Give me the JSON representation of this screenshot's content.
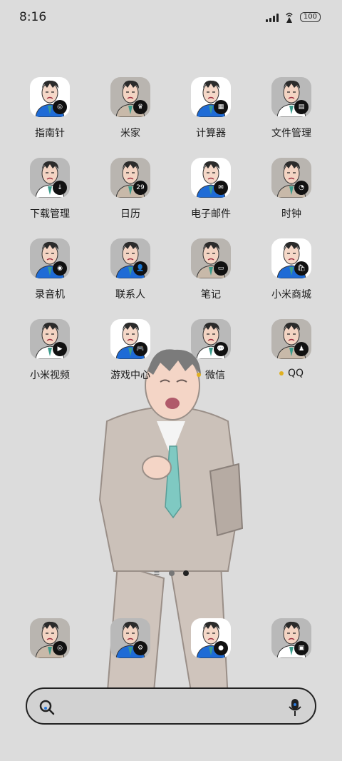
{
  "status_bar": {
    "time": "8:16",
    "battery": "100"
  },
  "apps": [
    {
      "label": "指南针",
      "icon": "compass-icon",
      "bg": "#ffffff",
      "shirt": "#1e6bd6",
      "badge": "◎"
    },
    {
      "label": "米家",
      "icon": "mijia-icon",
      "bg": "#b9b5b0",
      "shirt": "#c8b9a9",
      "badge": "♛"
    },
    {
      "label": "计算器",
      "icon": "calculator-icon",
      "bg": "#ffffff",
      "shirt": "#1e6bd6",
      "badge": "▦"
    },
    {
      "label": "文件管理",
      "icon": "file-manager-icon",
      "bg": "#b9b9b9",
      "shirt": "#ffffff",
      "badge": "▤"
    },
    {
      "label": "下载管理",
      "icon": "download-manager-icon",
      "bg": "#b9b9b9",
      "shirt": "#ffffff",
      "badge": "↓"
    },
    {
      "label": "日历",
      "icon": "calendar-icon",
      "bg": "#b9b5b0",
      "shirt": "#c8b9a9",
      "badge": "29"
    },
    {
      "label": "电子邮件",
      "icon": "email-icon",
      "bg": "#ffffff",
      "shirt": "#1e6bd6",
      "badge": "✉"
    },
    {
      "label": "时钟",
      "icon": "clock-icon",
      "bg": "#b9b5b0",
      "shirt": "#c8b9a9",
      "badge": "◔"
    },
    {
      "label": "录音机",
      "icon": "recorder-icon",
      "bg": "#b9b9b9",
      "shirt": "#1e6bd6",
      "badge": "◉"
    },
    {
      "label": "联系人",
      "icon": "contacts-icon",
      "bg": "#b9b9b9",
      "shirt": "#1e6bd6",
      "badge": "👤"
    },
    {
      "label": "笔记",
      "icon": "notes-icon",
      "bg": "#b9b5b0",
      "shirt": "#c8b9a9",
      "badge": "▭"
    },
    {
      "label": "小米商城",
      "icon": "mi-store-icon",
      "bg": "#ffffff",
      "shirt": "#1e6bd6",
      "badge": "🛍"
    },
    {
      "label": "小米视频",
      "icon": "mi-video-icon",
      "bg": "#b9b9b9",
      "shirt": "#ffffff",
      "badge": "▶"
    },
    {
      "label": "游戏中心",
      "icon": "game-center-icon",
      "bg": "#ffffff",
      "shirt": "#1e6bd6",
      "badge": "🎮"
    },
    {
      "label": "微信",
      "icon": "wechat-icon",
      "bg": "#b9b9b9",
      "shirt": "#ffffff",
      "badge": "💬",
      "dot": true
    },
    {
      "label": "QQ",
      "icon": "qq-icon",
      "bg": "#b9b5b0",
      "shirt": "#c8b9a9",
      "badge": "♟",
      "dot": true
    }
  ],
  "dock": [
    {
      "icon": "camera-icon",
      "bg": "#b9b5b0",
      "shirt": "#c8b9a9",
      "badge": "◎"
    },
    {
      "icon": "settings-icon",
      "bg": "#b9b9b9",
      "shirt": "#1e6bd6",
      "badge": "⚙"
    },
    {
      "icon": "messages-icon",
      "bg": "#ffffff",
      "shirt": "#1e6bd6",
      "badge": "●"
    },
    {
      "icon": "gallery-icon",
      "bg": "#b9b9b9",
      "shirt": "#ffffff",
      "badge": "▣"
    }
  ],
  "search": {
    "icon": "search-icon",
    "mic": "mic-icon"
  }
}
